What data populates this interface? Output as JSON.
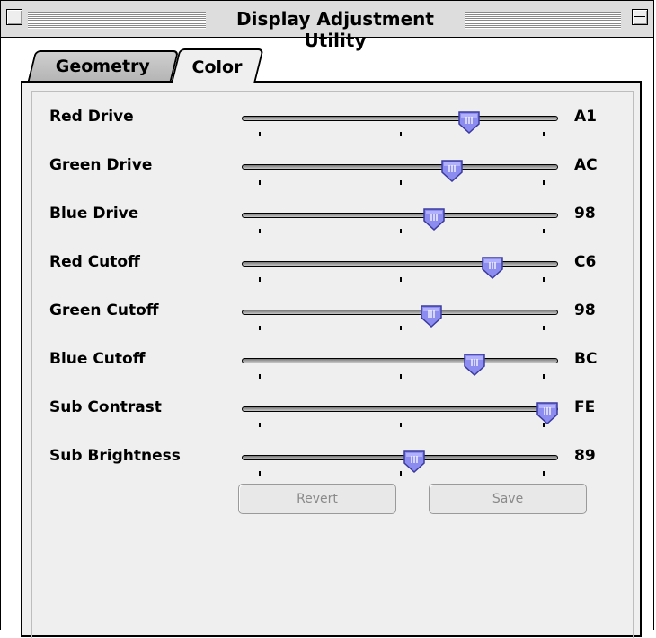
{
  "window": {
    "title": "Display Adjustment Utility"
  },
  "tabs": [
    {
      "label": "Geometry",
      "selected": false
    },
    {
      "label": "Color",
      "selected": true
    }
  ],
  "sliders": [
    {
      "label": "Red Drive",
      "value": "A1",
      "level": 0.72
    },
    {
      "label": "Green Drive",
      "value": "AC",
      "level": 0.66
    },
    {
      "label": "Blue Drive",
      "value": "98",
      "level": 0.6
    },
    {
      "label": "Red Cutoff",
      "value": "C6",
      "level": 0.8
    },
    {
      "label": "Green Cutoff",
      "value": "98",
      "level": 0.59
    },
    {
      "label": "Blue Cutoff",
      "value": "BC",
      "level": 0.74
    },
    {
      "label": "Sub Contrast",
      "value": "FE",
      "level": 0.99
    },
    {
      "label": "Sub Brightness",
      "value": "89",
      "level": 0.53
    }
  ],
  "buttons": {
    "revert_label": "Revert",
    "save_label": "Save"
  },
  "colors": {
    "thumb": "#8c8cf0",
    "thumb_dark": "#3a3aa0",
    "panel": "#efefef"
  }
}
